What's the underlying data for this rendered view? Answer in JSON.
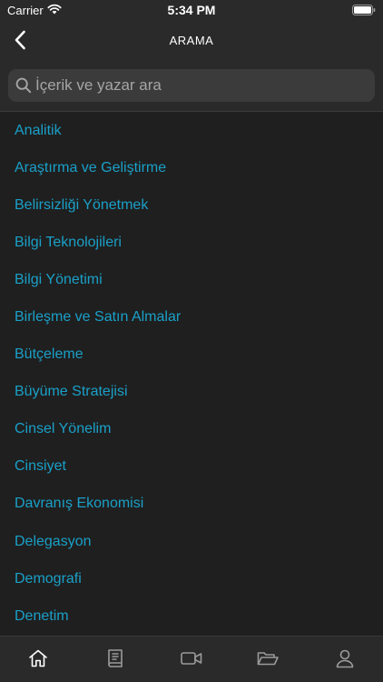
{
  "status_bar": {
    "carrier": "Carrier",
    "time": "5:34 PM"
  },
  "nav": {
    "title": "ARAMA"
  },
  "search": {
    "placeholder": "İçerik ve yazar ara"
  },
  "topics": [
    "Analitik",
    "Araştırma ve Geliştirme",
    "Belirsizliği Yönetmek",
    "Bilgi Teknolojileri",
    "Bilgi Yönetimi",
    "Birleşme ve Satın Almalar",
    "Bütçeleme",
    "Büyüme Stratejisi",
    "Cinsel Yönelim",
    "Cinsiyet",
    "Davranış Ekonomisi",
    "Delegasyon",
    "Demografi",
    "Denetim"
  ],
  "tabs": [
    {
      "icon": "home-icon"
    },
    {
      "icon": "book-icon"
    },
    {
      "icon": "video-icon"
    },
    {
      "icon": "folder-icon"
    },
    {
      "icon": "profile-icon"
    }
  ],
  "colors": {
    "link": "#1aa0c8",
    "bar_background": "#2a2a2a",
    "list_background": "#1f1f1f",
    "search_field": "#3b3b3b"
  }
}
